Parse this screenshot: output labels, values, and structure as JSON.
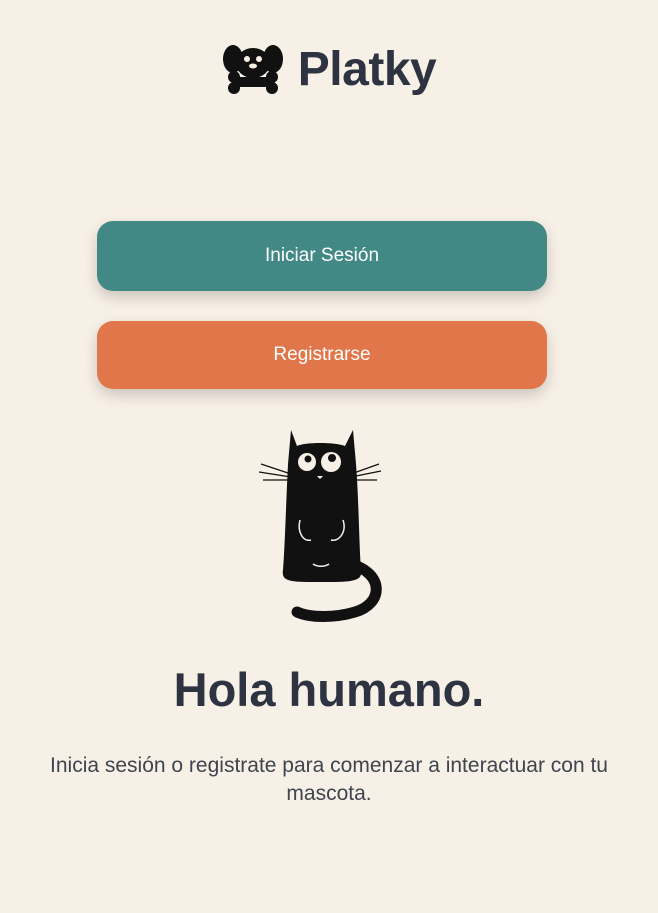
{
  "app": {
    "brand_name": "Platky",
    "logo_icon": "dog-with-bone-icon"
  },
  "actions": {
    "login_label": "Iniciar Sesión",
    "register_label": "Registrarse"
  },
  "illustration": {
    "icon": "black-cat-illustration"
  },
  "welcome": {
    "title": "Hola humano.",
    "message": "Inicia sesión o registrate para comenzar a interactuar con tu mascota."
  },
  "colors": {
    "background": "#f7f0e6",
    "primary": "#428885",
    "secondary": "#e07649",
    "text": "#2d3340"
  }
}
